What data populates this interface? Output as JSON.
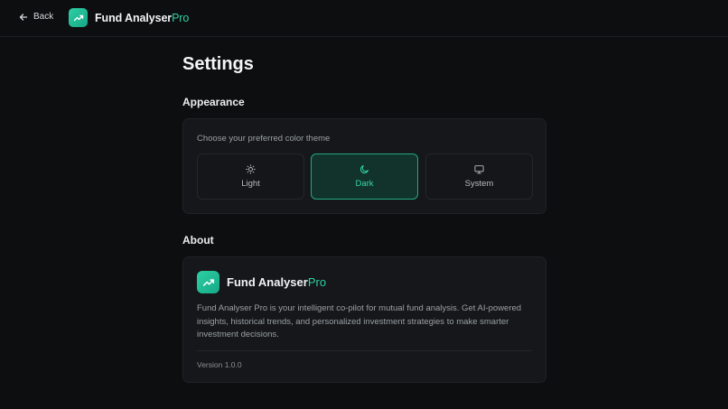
{
  "header": {
    "back_label": "Back",
    "brand_main": "Fund Analyser",
    "brand_accent": "Pro"
  },
  "page": {
    "title": "Settings"
  },
  "appearance": {
    "heading": "Appearance",
    "hint": "Choose your preferred color theme",
    "options": [
      {
        "label": "Light",
        "icon": "sun-icon",
        "selected": false
      },
      {
        "label": "Dark",
        "icon": "moon-icon",
        "selected": true
      },
      {
        "label": "System",
        "icon": "monitor-icon",
        "selected": false
      }
    ]
  },
  "about": {
    "heading": "About",
    "brand_main": "Fund Analyser",
    "brand_accent": "Pro",
    "description": "Fund Analyser Pro is your intelligent co-pilot for mutual fund analysis. Get AI-powered insights, historical trends, and personalized investment strategies to make smarter investment decisions.",
    "version": "Version 1.0.0"
  },
  "colors": {
    "accent": "#2ed1a5",
    "background": "#0d0e10",
    "card": "#15171a",
    "selected_bg": "#12332c"
  }
}
